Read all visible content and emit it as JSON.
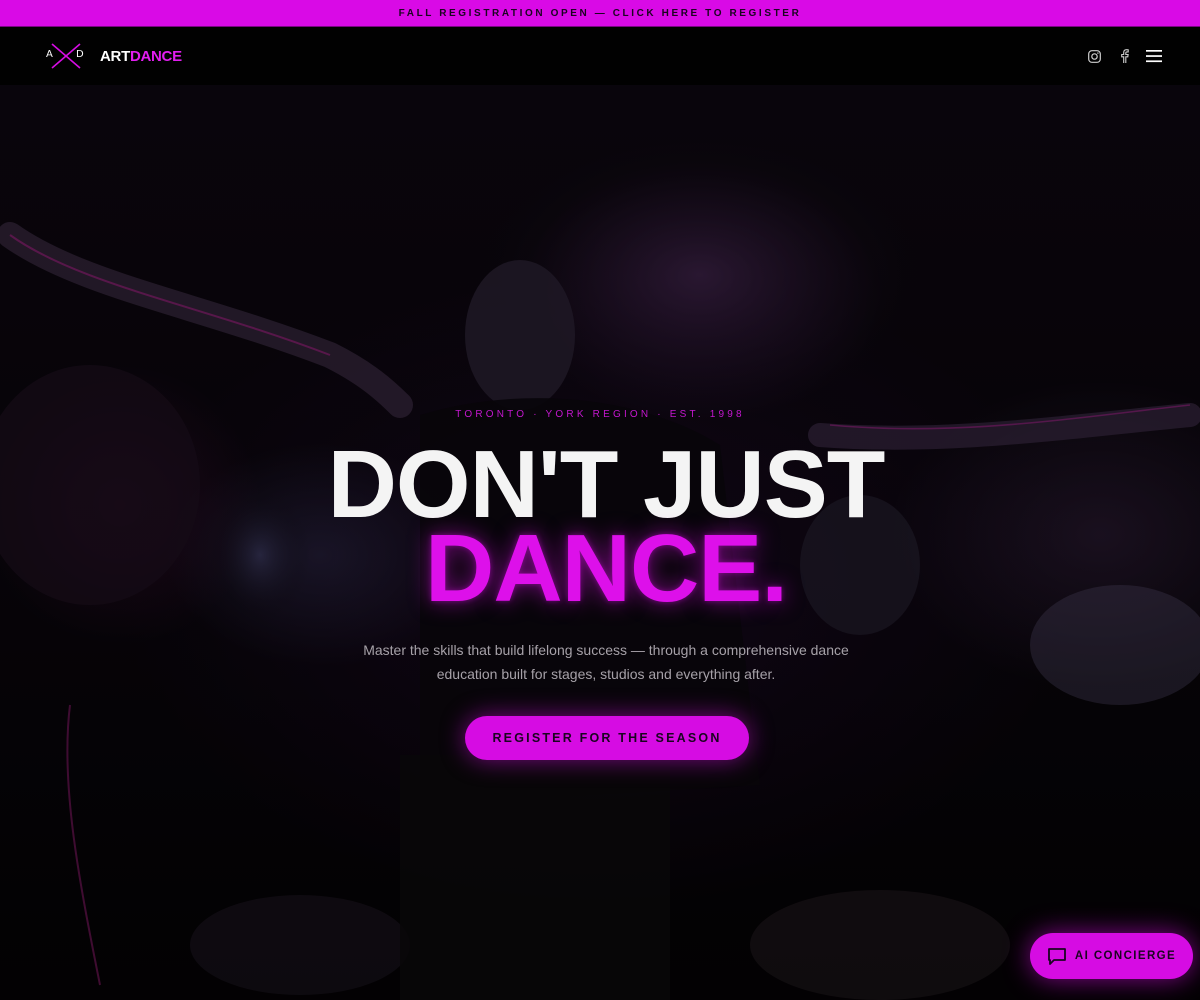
{
  "announcement": {
    "text": "FALL REGISTRATION OPEN — CLICK HERE TO REGISTER"
  },
  "brand": {
    "logo_left": "A",
    "logo_right": "D",
    "name_part1": "ART",
    "name_part2": "DANCE"
  },
  "nav": {
    "icons": [
      "instagram-icon",
      "facebook-icon",
      "menu-icon"
    ]
  },
  "hero": {
    "eyebrow": "TORONTO · YORK REGION · EST. 1998",
    "headline_line1": "DON'T JUST",
    "headline_line2": "DANCE.",
    "subcopy": "Master the skills that build lifelong success — through a comprehensive dance education built for stages, studios and everything after.",
    "cta_label": "REGISTER FOR THE SEASON"
  },
  "concierge": {
    "label": "AI CONCIERGE",
    "icon": "chat-icon"
  },
  "colors": {
    "accent": "#d60ce3",
    "headline": "#f4f4f4",
    "background": "#050306"
  }
}
